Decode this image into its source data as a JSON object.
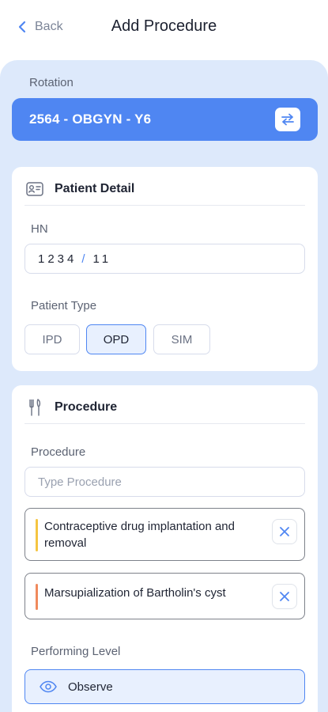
{
  "header": {
    "back_label": "Back",
    "title": "Add Procedure"
  },
  "rotation": {
    "label": "Rotation",
    "value": "2564 - OBGYN - Y6"
  },
  "patient_detail": {
    "title": "Patient Detail",
    "hn_label": "HN",
    "hn_value_main": "1234",
    "hn_separator": "/",
    "hn_value_sub": "11",
    "patient_type_label": "Patient Type",
    "patient_types": [
      "IPD",
      "OPD",
      "SIM"
    ],
    "selected_type": "OPD"
  },
  "procedure": {
    "title": "Procedure",
    "field_label": "Procedure",
    "placeholder": "Type Procedure",
    "items": [
      {
        "label": "Contraceptive drug implantation and removal",
        "accent": "#f5c542"
      },
      {
        "label": "Marsupialization of Bartholin's cyst",
        "accent": "#f08a5d"
      }
    ],
    "performing_level_label": "Performing Level",
    "performing_level": "Observe"
  },
  "colors": {
    "primary": "#4f86f2",
    "panel_bg": "#dde9fb"
  }
}
